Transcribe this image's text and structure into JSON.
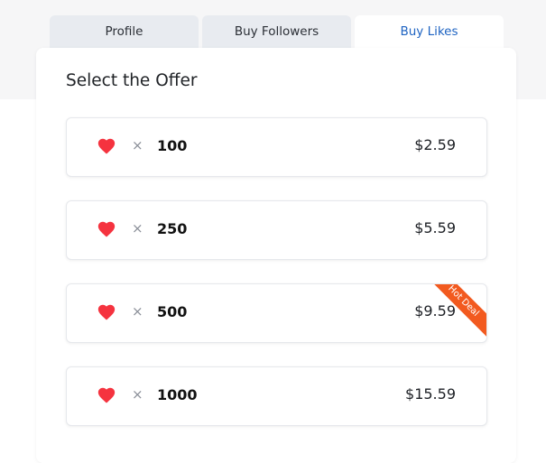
{
  "tabs": [
    {
      "label": "Profile"
    },
    {
      "label": "Buy Followers"
    },
    {
      "label": "Buy Likes"
    }
  ],
  "colors": {
    "active_tab_text": "#1e63c2",
    "heart": "#f5333f",
    "ribbon": "#f25a1f"
  },
  "offers_section": {
    "title": "Select the Offer",
    "times_symbol": "×",
    "icon": "heart-icon",
    "items": [
      {
        "quantity": "100",
        "price": "$2.59"
      },
      {
        "quantity": "250",
        "price": "$5.59"
      },
      {
        "quantity": "500",
        "price": "$9.59",
        "badge": "Hot Deal"
      },
      {
        "quantity": "1000",
        "price": "$15.59"
      }
    ]
  }
}
